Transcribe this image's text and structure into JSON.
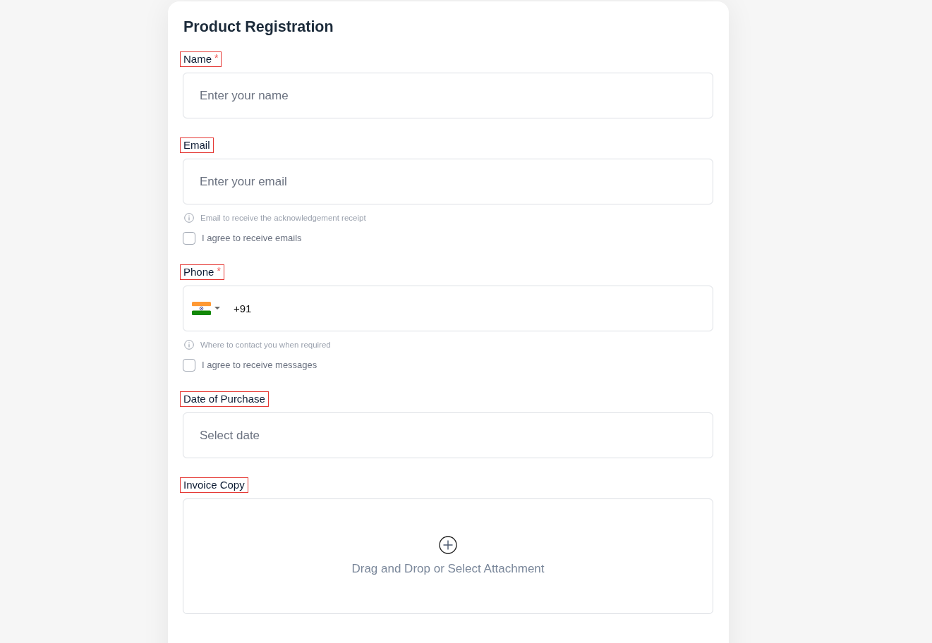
{
  "form": {
    "title": "Product Registration",
    "fields": [
      {
        "kind": "text",
        "label": "Name",
        "required_mark": "*",
        "highlighted": true,
        "placeholder": "Enter your name"
      },
      {
        "kind": "text",
        "label": "Email",
        "highlighted": true,
        "placeholder": "Enter your email",
        "hint": "Email to receive the acknowledgement receipt",
        "consent": {
          "label": "I agree to receive emails",
          "checked": false
        }
      },
      {
        "kind": "phone",
        "label": "Phone",
        "required_mark": "*",
        "highlighted": true,
        "value": "+91",
        "hint": "Where to contact you when required",
        "consent": {
          "label": "I agree to receive messages",
          "checked": false
        }
      },
      {
        "kind": "date",
        "label": "Date of Purchase",
        "highlighted": true,
        "placeholder": "Select date"
      },
      {
        "kind": "upload",
        "label": "Invoice Copy",
        "highlighted": true,
        "prompt": "Drag and Drop or Select Attachment"
      }
    ]
  }
}
